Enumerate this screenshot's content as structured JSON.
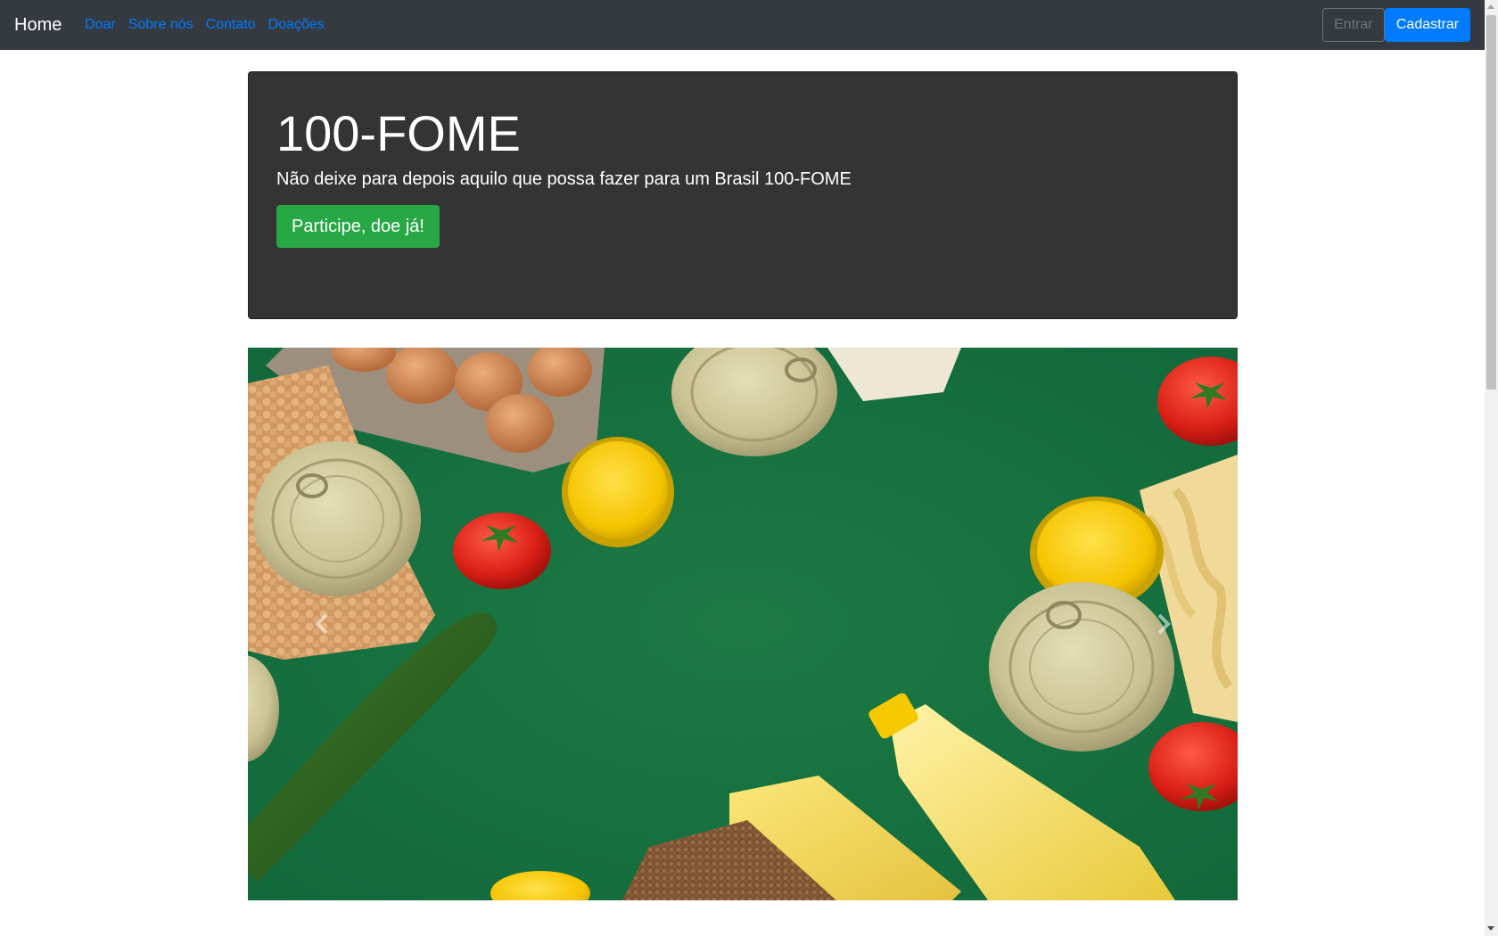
{
  "navbar": {
    "brand": "Home",
    "links": [
      "Doar",
      "Sobre nós",
      "Contato",
      "Doações"
    ],
    "login_placeholder": "Entrar",
    "signup_label": "Cadastrar"
  },
  "jumbotron": {
    "title": "100-FOME",
    "lead": "Não deixe para depois aquilo que possa fazer para um Brasil 100-FOME",
    "cta_label": "Participe, doe já!"
  },
  "carousel": {
    "slide_icon": "food-donation-photo",
    "prev_icon": "chevron-left-icon",
    "next_icon": "chevron-right-icon"
  },
  "colors": {
    "navbar_bg": "#343a40",
    "link": "#007bff",
    "primary": "#007bff",
    "success": "#28a745",
    "jumbotron_bg": "#343434",
    "carousel_bg": "#17703f"
  }
}
